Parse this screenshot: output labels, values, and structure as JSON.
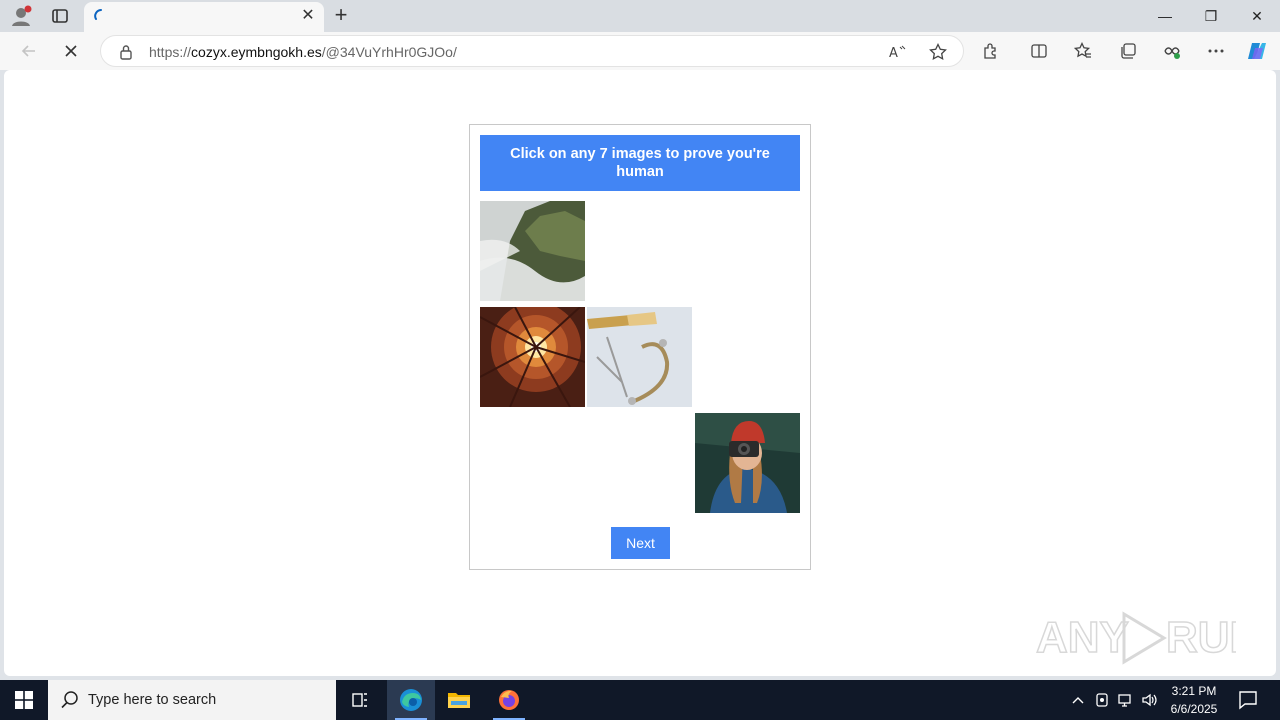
{
  "browser": {
    "tab": {
      "title": "",
      "close_label": "✕",
      "loading": true
    },
    "new_tab_label": "+",
    "window_controls": {
      "minimize": "—",
      "restore": "❐",
      "close": "✕"
    },
    "address": {
      "url_prefix": "https://",
      "domain": "cozyx.eymbngokh.es",
      "path": "/@34VuYrhHr0GJOo/"
    },
    "icons": [
      "back-icon",
      "stop-icon",
      "lock-icon",
      "read-aloud-icon",
      "favorite-star-icon",
      "extensions-icon",
      "split-screen-icon",
      "favorites-icon",
      "collections-icon",
      "browser-essentials-icon",
      "more-icon",
      "copilot-icon"
    ]
  },
  "captcha": {
    "instruction": "Click on any 7 images to prove you're human",
    "next_label": "Next",
    "accent_color": "#4285f4",
    "grid": [
      {
        "cell": 1,
        "image": "foggy-mountain-cliff"
      },
      {
        "cell": 4,
        "image": "looking-up-building-courtyard-sun"
      },
      {
        "cell": 5,
        "image": "pen-and-hair-clip"
      },
      {
        "cell": 9,
        "image": "woman-red-hat-camera"
      }
    ]
  },
  "watermark": {
    "text": "ANY RUN"
  },
  "taskbar": {
    "search_placeholder": "Type here to search",
    "time": "3:21 PM",
    "date": "6/6/2025",
    "apps": [
      "task-view-icon",
      "edge-icon",
      "file-explorer-icon",
      "firefox-icon"
    ],
    "tray": [
      "chevron-up-icon",
      "meet-now-icon",
      "network-icon",
      "volume-icon"
    ]
  }
}
